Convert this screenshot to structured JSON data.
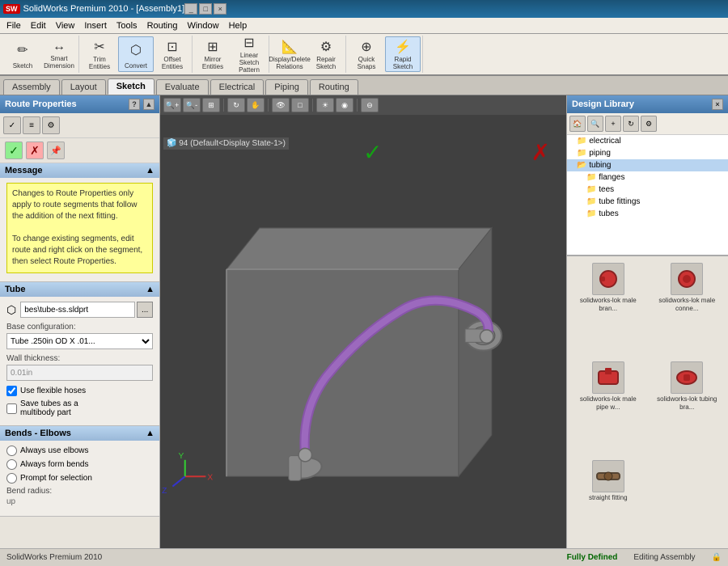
{
  "titlebar": {
    "logo": "SW",
    "title": "SolidWorks Premium 2010 - [Assembly1]",
    "controls": [
      "_",
      "□",
      "×"
    ]
  },
  "menubar": {
    "items": [
      "File",
      "Edit",
      "View",
      "Insert",
      "Tools",
      "Routing",
      "Window",
      "Help"
    ]
  },
  "tabs": {
    "items": [
      "Assembly",
      "Layout",
      "Sketch",
      "Evaluate",
      "Electrical",
      "Piping",
      "Routing"
    ],
    "active": "Sketch"
  },
  "toolbar": {
    "groups": [
      {
        "buttons": [
          {
            "id": "sketch",
            "label": "Sketch",
            "icon": "✏"
          },
          {
            "id": "smart-dimension",
            "label": "Smart\nDimension",
            "icon": "↔"
          }
        ]
      },
      {
        "buttons": [
          {
            "id": "trim-entities",
            "label": "Trim\nEntities",
            "icon": "✂"
          },
          {
            "id": "convert-entities",
            "label": "Convert\nEntities",
            "icon": "⬡",
            "active": true
          },
          {
            "id": "offset-entities",
            "label": "Offset\nEntities",
            "icon": "⊡"
          }
        ]
      },
      {
        "buttons": [
          {
            "id": "mirror-entities",
            "label": "Mirror Entities",
            "icon": "⊞"
          },
          {
            "id": "linear-sketch",
            "label": "Linear Sketch Pattern",
            "icon": "⊟"
          }
        ]
      },
      {
        "buttons": [
          {
            "id": "display-delete",
            "label": "Display/Delete\nRelations",
            "icon": "⊞"
          },
          {
            "id": "repair-sketch",
            "label": "Repair\nSketch",
            "icon": "⚙"
          }
        ]
      },
      {
        "buttons": [
          {
            "id": "quick-snaps",
            "label": "Quick\nSnaps",
            "icon": "⊕"
          },
          {
            "id": "rapid-sketch",
            "label": "Rapid\nSketch",
            "icon": "⚡",
            "active": true
          }
        ]
      }
    ]
  },
  "leftPanel": {
    "title": "Route Properties",
    "helpBtn": "?",
    "confirmButtons": {
      "ok": "✓",
      "cancel": "✗",
      "pin": "📌"
    },
    "sections": {
      "message": {
        "title": "Message",
        "text1": "Changes to Route Properties only apply to route segments that follow the addition of the next fitting.",
        "text2": "To change existing segments, edit route and right click on the segment, then select Route Properties."
      },
      "tube": {
        "title": "Tube",
        "fileLabel": "",
        "fileValue": "bes\\tube-ss.sldprt",
        "browseLabel": "...",
        "baseConfigLabel": "Base configuration:",
        "baseConfigValue": "Tube .250in OD X .01...",
        "wallThicknessLabel": "Wall thickness:",
        "wallThicknessValue": "0.01in",
        "useFlexibleHoses": true,
        "useFlexibleLabel": "Use flexible hoses",
        "saveTubes": false,
        "saveTubesLabel": "Save tubes as a\nmultibody part"
      },
      "bends": {
        "title": "Bends - Elbows",
        "alwaysUseElbows": false,
        "alwaysUseElbowsLabel": "Always use elbows",
        "alwaysFormBends": false,
        "alwaysFormBendsLabel": "Always form bends",
        "promptForSelection": false,
        "promptLabel": "Prompt for selection",
        "bendRadiusLabel": "Bend radius:",
        "bendRadiusValue": "up"
      }
    }
  },
  "viewport": {
    "breadcrumb": "94  (Default<Display State-1>)",
    "checkmark": "✓",
    "xmark": "✗"
  },
  "rightPanel": {
    "title": "Design Library",
    "closeBtn": "×",
    "tree": {
      "items": [
        {
          "level": 1,
          "label": "electrical",
          "type": "folder"
        },
        {
          "level": 1,
          "label": "piping",
          "type": "folder"
        },
        {
          "level": 1,
          "label": "tubing",
          "type": "folder",
          "expanded": true
        },
        {
          "level": 2,
          "label": "flanges",
          "type": "folder"
        },
        {
          "level": 2,
          "label": "tees",
          "type": "folder"
        },
        {
          "level": 2,
          "label": "tube fittings",
          "type": "folder"
        },
        {
          "level": 2,
          "label": "tubes",
          "type": "folder"
        }
      ]
    },
    "thumbnails": [
      {
        "id": "t1",
        "label": "solidworks-lok male bran...",
        "color": "#cc3333"
      },
      {
        "id": "t2",
        "label": "solidworks-lok male conne...",
        "color": "#cc3333"
      },
      {
        "id": "t3",
        "label": "solidworks-lok male pipe w...",
        "color": "#cc3333"
      },
      {
        "id": "t4",
        "label": "solidworks-lok tubing bra...",
        "color": "#cc3333"
      },
      {
        "id": "t5",
        "label": "straight fitting",
        "color": "#886655"
      }
    ]
  },
  "statusbar": {
    "left": "SolidWorks Premium 2010",
    "center": "Fully Defined",
    "right": "Editing Assembly"
  }
}
